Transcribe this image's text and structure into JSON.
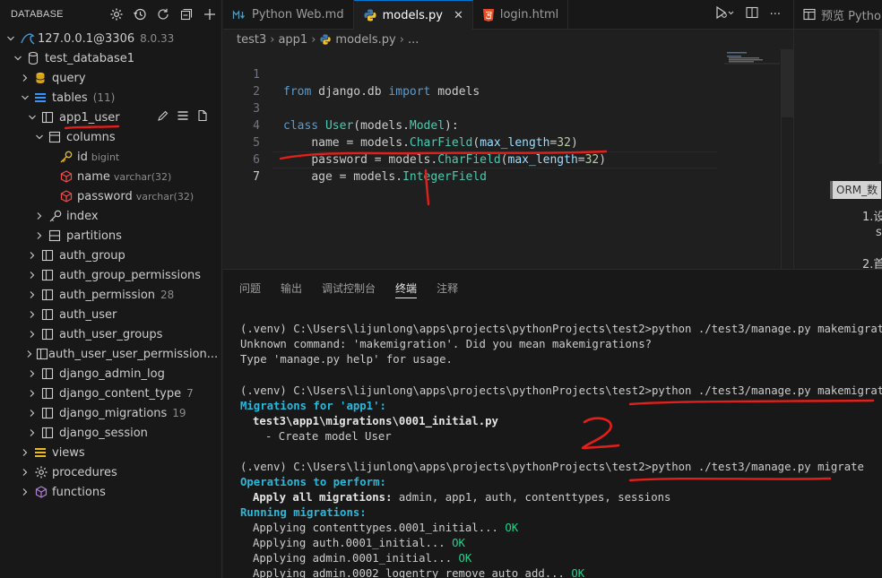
{
  "sidebar": {
    "title": "DATABASE",
    "connection": {
      "label": "127.0.0.1@3306",
      "version": "8.0.33"
    },
    "database": {
      "label": "test_database1"
    },
    "query": {
      "label": "query"
    },
    "tables_group": {
      "label": "tables",
      "count": "(11)"
    },
    "selected_table": {
      "label": "app1_user"
    },
    "columns_group": {
      "label": "columns"
    },
    "columns": [
      {
        "name": "id",
        "type": "bigint"
      },
      {
        "name": "name",
        "type": "varchar(32)"
      },
      {
        "name": "password",
        "type": "varchar(32)"
      }
    ],
    "index": {
      "label": "index"
    },
    "partitions": {
      "label": "partitions"
    },
    "tables": [
      {
        "label": "auth_group",
        "count": ""
      },
      {
        "label": "auth_group_permissions",
        "count": ""
      },
      {
        "label": "auth_permission",
        "count": "28"
      },
      {
        "label": "auth_user",
        "count": ""
      },
      {
        "label": "auth_user_groups",
        "count": ""
      },
      {
        "label": "auth_user_user_permission...",
        "count": ""
      },
      {
        "label": "django_admin_log",
        "count": ""
      },
      {
        "label": "django_content_type",
        "count": "7"
      },
      {
        "label": "django_migrations",
        "count": "19"
      },
      {
        "label": "django_session",
        "count": ""
      }
    ],
    "views": {
      "label": "views"
    },
    "procedures": {
      "label": "procedures"
    },
    "functions": {
      "label": "functions"
    }
  },
  "tabs": [
    {
      "label": "Python Web.md",
      "icon": "markdown-icon"
    },
    {
      "label": "models.py",
      "icon": "python-icon"
    },
    {
      "label": "login.html",
      "icon": "html5-icon"
    }
  ],
  "breadcrumb": {
    "parts": [
      "test3",
      "app1",
      "models.py",
      "..."
    ]
  },
  "code": {
    "line_numbers": [
      "1",
      "2",
      "3",
      "4",
      "5",
      "6",
      "7"
    ],
    "line1": {
      "kw_from": "from",
      "module": "django.db",
      "kw_import": "import",
      "name": "models"
    },
    "line3": {
      "kw_class": "class",
      "cls": "User",
      "base_obj": "models",
      "base": "Model",
      "colon": "):"
    },
    "line4": {
      "field": "name",
      "eq": " = models.",
      "type": "CharField",
      "param": "max_length",
      "value": "32"
    },
    "line5": {
      "field": "password",
      "eq": " = models.",
      "type": "CharField",
      "param": "max_length",
      "value": "32"
    },
    "line6": {
      "field": "age",
      "eq": " = models.",
      "type": "IntegerField"
    }
  },
  "preview": {
    "tab_label": "预览 Python",
    "chip": "ORM_数",
    "item1": "1.设",
    "item1b": "s",
    "item2": "2.首"
  },
  "panel": {
    "tabs": [
      "问题",
      "输出",
      "调试控制台",
      "终端",
      "注释"
    ],
    "active_tab": "终端"
  },
  "terminal": {
    "prompt": "(.venv) C:\\Users\\lijunlong\\apps\\projects\\pythonProjects\\test2>",
    "cmd1": "python ./test3/manage.py makemigration",
    "err1": "Unknown command: 'makemigration'. Did you mean makemigrations?",
    "err2": "Type 'manage.py help' for usage.",
    "cmd2": "python ./test3/manage.py makemigrations",
    "mig_for": "Migrations for 'app1':",
    "mig_file": "test3\\app1\\migrations\\0001_initial.py",
    "mig_create": "- Create model User",
    "cmd3": "python ./test3/manage.py migrate",
    "ops": "Operations to perform:",
    "apply_all_label": "Apply all migrations:",
    "apply_all_value": " admin, app1, auth, contenttypes, sessions",
    "running": "Running migrations:",
    "applying": [
      {
        "text": "Applying contenttypes.0001_initial...",
        "status": "OK"
      },
      {
        "text": "Applying auth.0001_initial...",
        "status": "OK"
      },
      {
        "text": "Applying admin.0001_initial...",
        "status": "OK"
      },
      {
        "text": "Applying admin.0002_logentry_remove_auto_add...",
        "status": "OK"
      }
    ]
  },
  "annotations": {
    "mark1": "1",
    "mark2": "2"
  },
  "colors": {
    "accent": "#0078d4",
    "annotation": "#e0201a",
    "ok": "#23d18b",
    "cyan": "#29b8db"
  }
}
